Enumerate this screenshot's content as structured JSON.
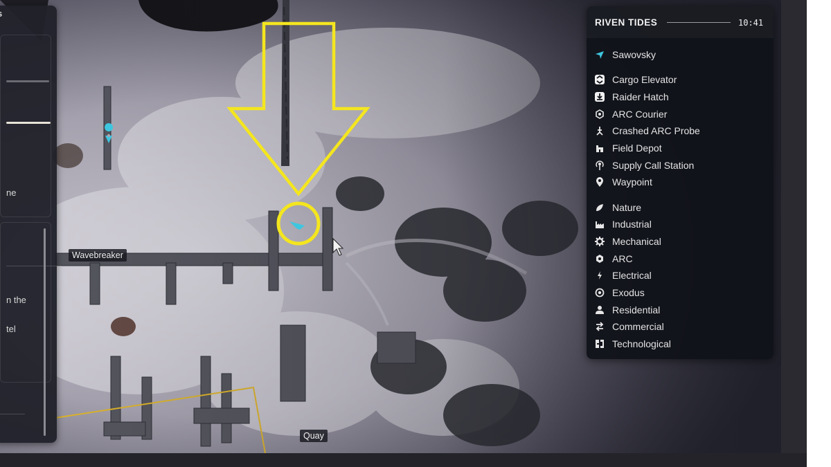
{
  "legend": {
    "title": "RIVEN TIDES",
    "time": "10:41",
    "player": {
      "label": "Sawovsky",
      "icon": "player-arrow-icon",
      "color": "#3ec6e0"
    },
    "points": [
      {
        "label": "Cargo Elevator",
        "icon": "cargo-elevator-icon"
      },
      {
        "label": "Raider Hatch",
        "icon": "raider-hatch-icon"
      },
      {
        "label": "ARC Courier",
        "icon": "arc-courier-icon"
      },
      {
        "label": "Crashed ARC Probe",
        "icon": "crashed-arc-probe-icon"
      },
      {
        "label": "Field Depot",
        "icon": "field-depot-icon"
      },
      {
        "label": "Supply Call Station",
        "icon": "supply-call-station-icon"
      },
      {
        "label": "Waypoint",
        "icon": "waypoint-icon"
      }
    ],
    "categories": [
      {
        "label": "Nature",
        "icon": "nature-icon"
      },
      {
        "label": "Industrial",
        "icon": "industrial-icon"
      },
      {
        "label": "Mechanical",
        "icon": "mechanical-icon"
      },
      {
        "label": "ARC",
        "icon": "arc-icon"
      },
      {
        "label": "Electrical",
        "icon": "electrical-icon"
      },
      {
        "label": "Exodus",
        "icon": "exodus-icon"
      },
      {
        "label": "Residential",
        "icon": "residential-icon"
      },
      {
        "label": "Commercial",
        "icon": "commercial-icon"
      },
      {
        "label": "Technological",
        "icon": "technological-icon"
      }
    ]
  },
  "map": {
    "labels": {
      "wavebreaker": "Wavebreaker",
      "quay": "Quay"
    },
    "annotation_color": "#f4e61e",
    "player_color": "#3ec6e0",
    "zone_color": "#e0b62a"
  },
  "left_panel": {
    "fragments": {
      "top": "s",
      "row1": "ne",
      "row2": "n the",
      "row3": "tel"
    }
  }
}
